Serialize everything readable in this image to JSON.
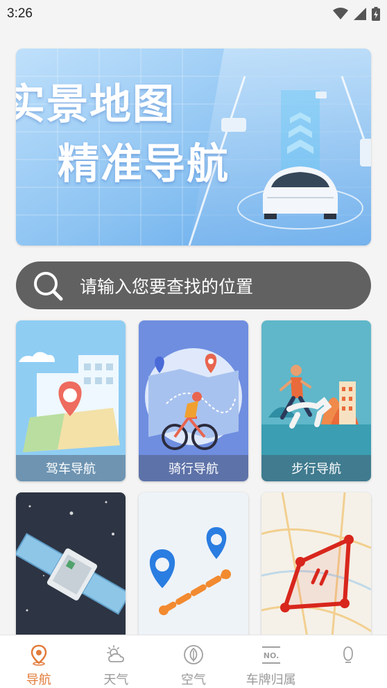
{
  "status_bar": {
    "time": "3:26"
  },
  "banner": {
    "line1": "实景地图",
    "line2": "精准导航"
  },
  "search": {
    "placeholder": "请输入您要查找的位置"
  },
  "cards": [
    {
      "label": "驾车导航"
    },
    {
      "label": "骑行导航"
    },
    {
      "label": "步行导航"
    },
    {
      "label": ""
    },
    {
      "label": ""
    },
    {
      "label": ""
    }
  ],
  "bottom_nav": {
    "items": [
      {
        "label": "导航",
        "icon": "location-pin-icon",
        "active": true
      },
      {
        "label": "天气",
        "icon": "weather-icon",
        "active": false
      },
      {
        "label": "空气",
        "icon": "leaf-icon",
        "active": false
      },
      {
        "label": "车牌归属",
        "icon": "license-plate-icon",
        "active": false
      },
      {
        "label": "",
        "icon": "more-icon",
        "active": false
      }
    ]
  },
  "colors": {
    "accent": "#e27b3a",
    "search_bg": "#616161",
    "nav_inactive": "#9a9a9a"
  }
}
